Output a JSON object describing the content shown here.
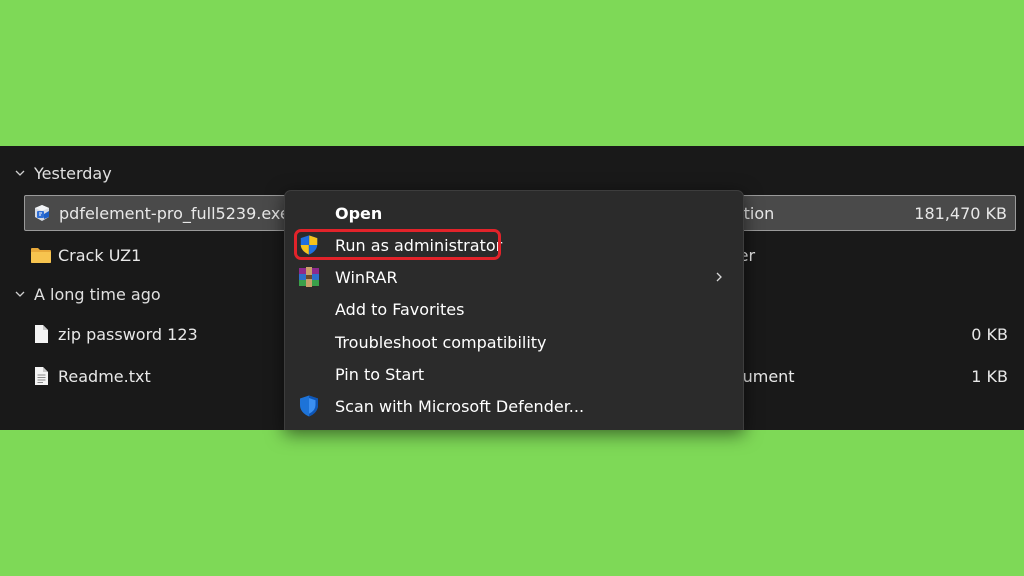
{
  "groups": {
    "yesterday": {
      "label": "Yesterday"
    },
    "long_ago": {
      "label": "A long time ago"
    }
  },
  "files": [
    {
      "name": "pdfelement-pro_full5239.exe",
      "type": "cation",
      "size": "181,470 KB",
      "icon": "installer-icon"
    },
    {
      "name": "Crack UZ1",
      "type": "lder",
      "size": "",
      "icon": "folder-icon"
    },
    {
      "name": "zip password 123",
      "type": "",
      "size": "0 KB",
      "icon": "file-icon"
    },
    {
      "name": "Readme.txt",
      "type": "ocument",
      "size": "1 KB",
      "icon": "text-file-icon"
    }
  ],
  "context_menu": {
    "items": [
      {
        "label": "Open",
        "icon": ""
      },
      {
        "label": "Run as administrator",
        "icon": "uac-shield-icon"
      },
      {
        "label": "WinRAR",
        "icon": "winrar-icon"
      },
      {
        "label": "Add to Favorites",
        "icon": ""
      },
      {
        "label": "Troubleshoot compatibility",
        "icon": ""
      },
      {
        "label": "Pin to Start",
        "icon": ""
      },
      {
        "label": "Scan with Microsoft Defender...",
        "icon": "defender-shield-icon"
      }
    ]
  },
  "colors": {
    "background": "#7ed957",
    "explorer_bg": "#191919",
    "menu_bg": "#2b2b2b",
    "highlight": "#e2232a",
    "selection_bg": "#4a4a4a"
  }
}
